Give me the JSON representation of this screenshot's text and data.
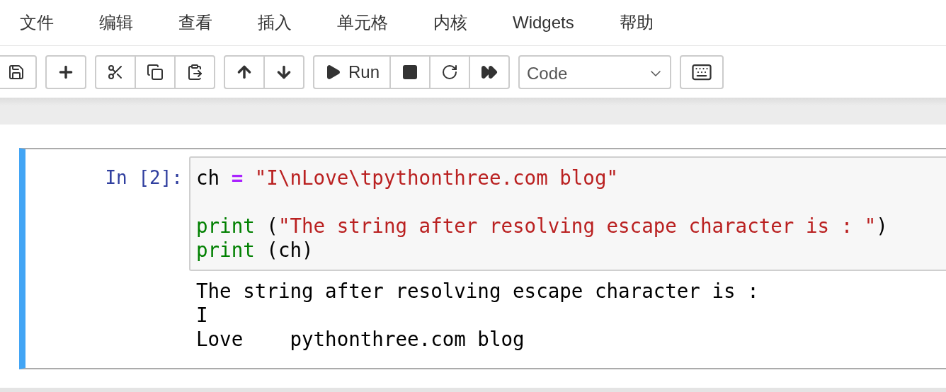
{
  "menu": [
    {
      "label": "文件"
    },
    {
      "label": "编辑"
    },
    {
      "label": "查看"
    },
    {
      "label": "插入"
    },
    {
      "label": "单元格"
    },
    {
      "label": "内核"
    },
    {
      "label": "Widgets"
    },
    {
      "label": "帮助"
    }
  ],
  "toolbar": [
    [
      {
        "kind": "save"
      }
    ],
    [
      {
        "kind": "add"
      }
    ],
    [
      {
        "kind": "cut"
      },
      {
        "kind": "copy"
      },
      {
        "kind": "paste"
      }
    ],
    [
      {
        "kind": "up"
      },
      {
        "kind": "down"
      }
    ],
    [
      {
        "kind": "run",
        "label": "Run"
      },
      {
        "kind": "stop"
      },
      {
        "kind": "restart"
      },
      {
        "kind": "run-all"
      }
    ]
  ],
  "cell_type_select": {
    "value": "Code"
  },
  "cell": {
    "selected": true,
    "prompt": "In [2]:",
    "code": [
      {
        "kind": "code",
        "tokens": [
          {
            "kind": "name",
            "text": "ch "
          },
          {
            "kind": "operator",
            "text": "="
          },
          {
            "kind": "string",
            "text": " \"I\\nLove\\tpythonthree.com blog\""
          }
        ]
      },
      {
        "kind": "blank"
      },
      {
        "kind": "code",
        "tokens": [
          {
            "kind": "builtin",
            "text": "print"
          },
          {
            "kind": "plain",
            "text": " ("
          },
          {
            "kind": "string",
            "text": "\"The string after resolving escape character is : \""
          },
          {
            "kind": "plain",
            "text": ")"
          }
        ]
      },
      {
        "kind": "code",
        "tokens": [
          {
            "kind": "builtin",
            "text": "print"
          },
          {
            "kind": "plain",
            "text": " (ch)"
          }
        ]
      }
    ],
    "output": [
      "The string after resolving escape character is :",
      "I",
      "Love    pythonthree.com blog"
    ]
  }
}
